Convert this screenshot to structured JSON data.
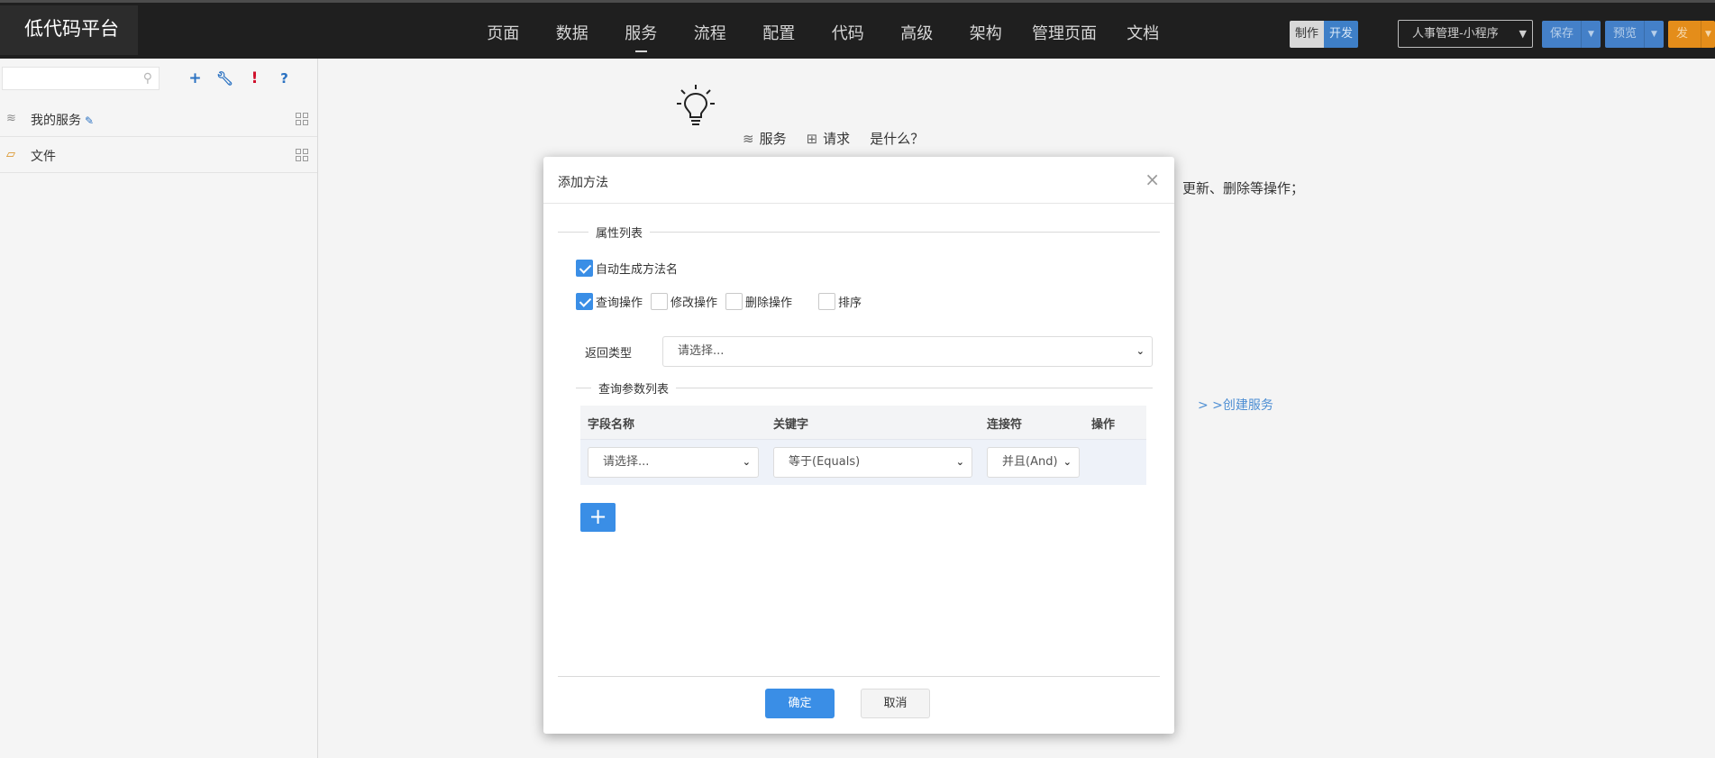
{
  "brand": {
    "title": "低代码平台"
  },
  "nav": {
    "items": [
      {
        "label": "页面"
      },
      {
        "label": "数据"
      },
      {
        "label": "服务",
        "active": true
      },
      {
        "label": "流程"
      },
      {
        "label": "配置"
      },
      {
        "label": "代码"
      },
      {
        "label": "高级"
      },
      {
        "label": "架构"
      },
      {
        "label": "管理页面"
      },
      {
        "label": "文档"
      }
    ]
  },
  "toolbar": {
    "mode_make": "制作",
    "mode_dev": "开发",
    "project_select": "人事管理-小程序",
    "save_label": "保存",
    "preview_label": "预览",
    "publish_label": "发布"
  },
  "sidebar": {
    "search_placeholder": "",
    "items": [
      {
        "label": "我的服务"
      },
      {
        "label": "文件"
      }
    ]
  },
  "main": {
    "links": [
      {
        "label": "服务"
      },
      {
        "label": "请求"
      },
      {
        "label": "是什么？"
      }
    ],
    "description_tail": "、更新、删除等操作；",
    "create_link": "> >创建服务"
  },
  "modal": {
    "title": "添加方法",
    "section_attr": "属性列表",
    "auto_name": {
      "label": "自动生成方法名",
      "checked": true
    },
    "ops": [
      {
        "label": "查询操作",
        "checked": true
      },
      {
        "label": "修改操作",
        "checked": false
      },
      {
        "label": "删除操作",
        "checked": false
      },
      {
        "label": "排序",
        "checked": false
      }
    ],
    "return_type_label": "返回类型",
    "return_type_value": "请选择...",
    "section_params": "查询参数列表",
    "param_columns": [
      "字段名称",
      "关键字",
      "连接符",
      "操作"
    ],
    "param_rows": [
      {
        "field": "请选择...",
        "keyword": "等于(Equals)",
        "connector": "并且(And)"
      }
    ],
    "add_row_label": "+",
    "ok_label": "确定",
    "cancel_label": "取消"
  },
  "colors": {
    "accent_blue": "#3a8ee6",
    "topbar_bg": "#1f1f1f",
    "publish_orange": "#e48d1a"
  }
}
